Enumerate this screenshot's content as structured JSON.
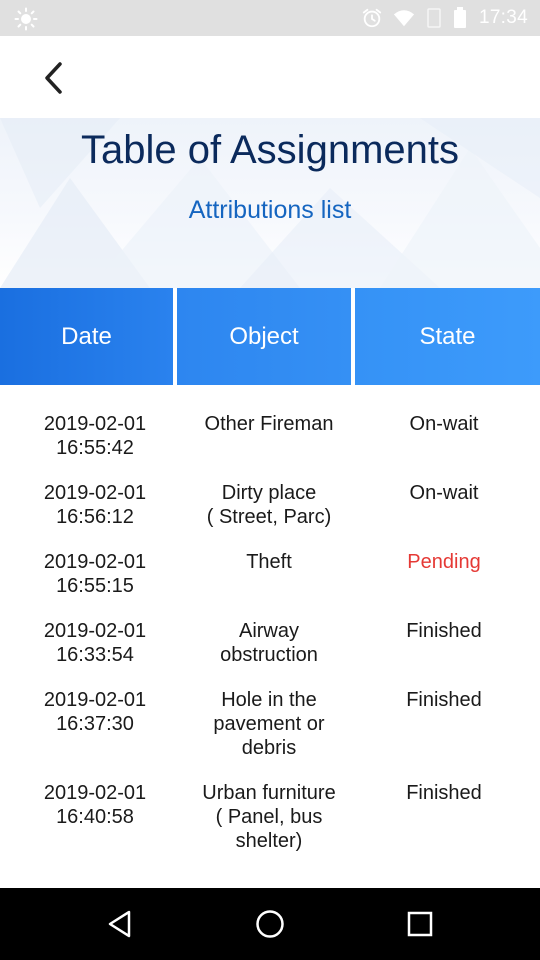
{
  "status_bar": {
    "time": "17:34",
    "icons": [
      "sun-icon",
      "alarm-icon",
      "wifi-icon",
      "signal-icon",
      "battery-icon"
    ]
  },
  "header": {
    "title": "Table of Assignments",
    "subtitle": "Attributions list"
  },
  "table": {
    "columns": [
      "Date",
      "Object",
      "State"
    ],
    "rows": [
      {
        "date": "2019-02-01",
        "time": "16:55:42",
        "object": [
          "Other Fireman"
        ],
        "state": "On-wait",
        "state_color": "#1a1a1a"
      },
      {
        "date": "2019-02-01",
        "time": "16:56:12",
        "object": [
          "Dirty place",
          "( Street, Parc)"
        ],
        "state": "On-wait",
        "state_color": "#1a1a1a"
      },
      {
        "date": "2019-02-01",
        "time": "16:55:15",
        "object": [
          "Theft"
        ],
        "state": "Pending",
        "state_color": "#e53935"
      },
      {
        "date": "2019-02-01",
        "time": "16:33:54",
        "object": [
          "Airway",
          "obstruction"
        ],
        "state": "Finished",
        "state_color": "#1a1a1a"
      },
      {
        "date": "2019-02-01",
        "time": "16:37:30",
        "object": [
          "Hole in the",
          "pavement or",
          "debris"
        ],
        "state": "Finished",
        "state_color": "#1a1a1a"
      },
      {
        "date": "2019-02-01",
        "time": "16:40:58",
        "object": [
          "Urban furniture",
          "( Panel, bus",
          "shelter)"
        ],
        "state": "Finished",
        "state_color": "#1a1a1a"
      }
    ]
  },
  "colors": {
    "title": "#0b2a5c",
    "subtitle": "#1565c0",
    "header_blue": "#2a82ee",
    "pending": "#e53935"
  },
  "nav_bar": {
    "icons": [
      "back-triangle-icon",
      "home-circle-icon",
      "recent-square-icon"
    ]
  }
}
